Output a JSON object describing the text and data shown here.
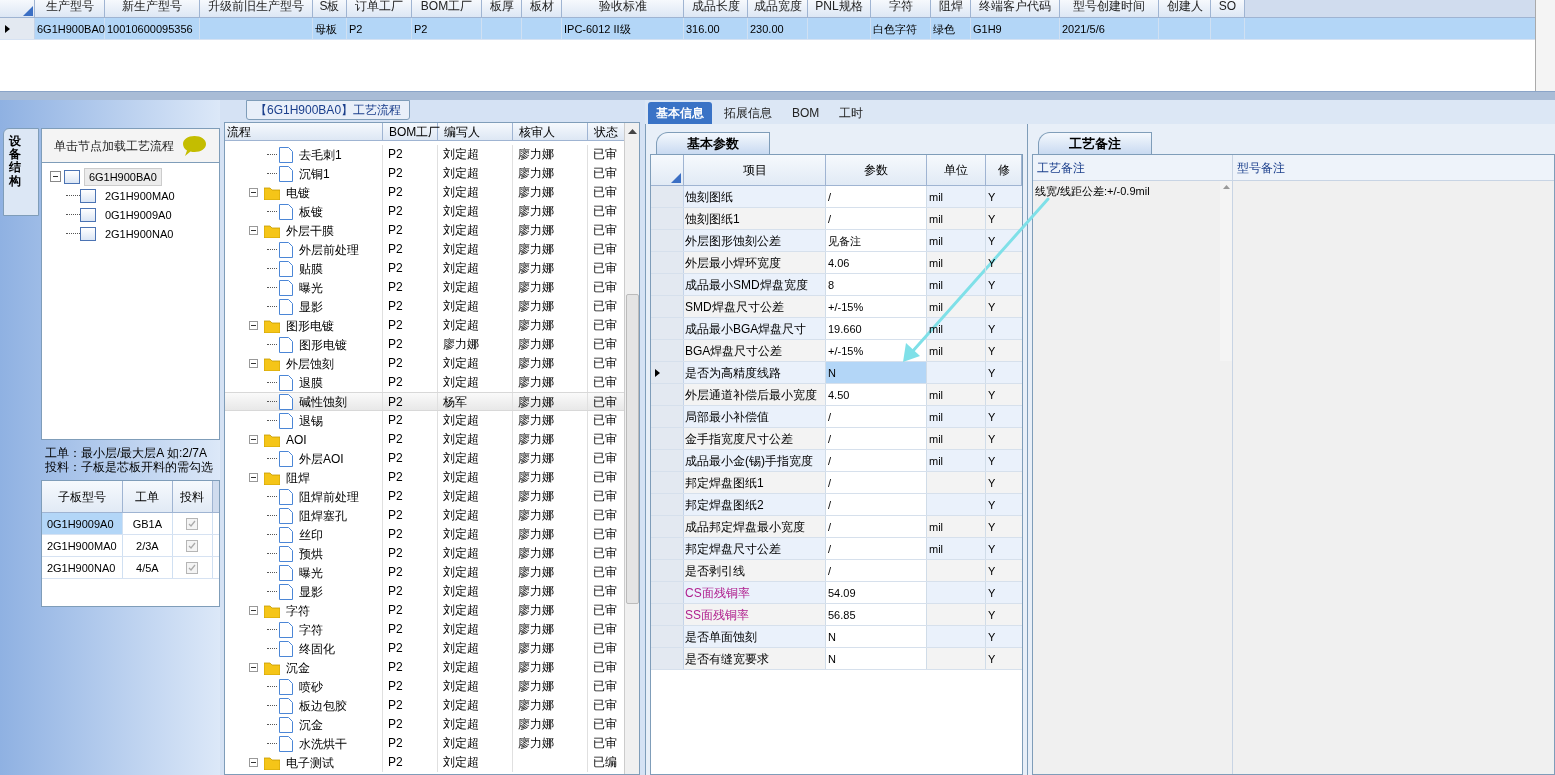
{
  "top_grid": {
    "columns": [
      "生产型号",
      "新生产型号",
      "升级前旧生产型号",
      "S板",
      "订单工厂",
      "BOM工厂",
      "板厚",
      "板材",
      "验收标准",
      "成品长度",
      "成品宽度",
      "PNL规格",
      "字符",
      "阻焊",
      "终端客户代码",
      "型号创建时间",
      "创建人",
      "SO"
    ],
    "rows": [
      {
        "selected": true,
        "cells": [
          "6G1H900BA0",
          "10010600095356",
          "",
          "母板",
          "P2",
          "P2",
          "",
          "",
          "IPC-6012 II级",
          "316.00",
          "230.00",
          "",
          "白色字符",
          "绿色",
          "G1H9",
          "2021/5/6",
          "",
          ""
        ]
      }
    ]
  },
  "left_panel": {
    "side_tab": "设备结构",
    "header": "单击节点加载工艺流程",
    "tree": [
      {
        "label": "6G1H900BA0",
        "selected": true,
        "expanded": true,
        "children": [
          {
            "label": "2G1H900MA0",
            "selected": false
          },
          {
            "label": "0G1H9009A0",
            "selected": false
          },
          {
            "label": "2G1H900NA0",
            "selected": false
          }
        ]
      }
    ],
    "note_lines": [
      "工单：最小层/最大层A 如:2/7A",
      "投料：子板是芯板开料的需勾选"
    ],
    "sub_grid": {
      "columns": [
        "子板型号",
        "工单",
        "投料"
      ],
      "rows": [
        {
          "board": "0G1H9009A0",
          "order": "GB1A",
          "checked": true,
          "selected": true
        },
        {
          "board": "2G1H900MA0",
          "order": "2/3A",
          "checked": true,
          "selected": false
        },
        {
          "board": "2G1H900NA0",
          "order": "4/5A",
          "checked": true,
          "selected": false
        }
      ]
    }
  },
  "process_panel": {
    "title": "【6G1H900BA0】工艺流程",
    "columns": [
      "流程",
      "BOM工厂",
      "编写人",
      "核审人",
      "状态"
    ],
    "rows": [
      {
        "kind": "cut",
        "children": [
          {
            "kind": "step",
            "label": "去毛刺1",
            "factory": "P2",
            "author": "刘定超",
            "reviewer": "廖力娜",
            "status": "已审",
            "selected": false
          },
          {
            "kind": "step",
            "label": "沉铜1",
            "factory": "P2",
            "author": "刘定超",
            "reviewer": "廖力娜",
            "status": "已审",
            "selected": false
          }
        ]
      },
      {
        "kind": "folder",
        "label": "电镀",
        "factory": "P2",
        "author": "刘定超",
        "reviewer": "廖力娜",
        "status": "已审",
        "expanded": true,
        "selected": false,
        "children": [
          {
            "kind": "step",
            "label": "板镀",
            "factory": "P2",
            "author": "刘定超",
            "reviewer": "廖力娜",
            "status": "已审",
            "selected": false
          }
        ]
      },
      {
        "kind": "folder",
        "label": "外层干膜",
        "factory": "P2",
        "author": "刘定超",
        "reviewer": "廖力娜",
        "status": "已审",
        "expanded": true,
        "selected": false,
        "children": [
          {
            "kind": "step",
            "label": "外层前处理",
            "factory": "P2",
            "author": "刘定超",
            "reviewer": "廖力娜",
            "status": "已审",
            "selected": false
          },
          {
            "kind": "step",
            "label": "贴膜",
            "factory": "P2",
            "author": "刘定超",
            "reviewer": "廖力娜",
            "status": "已审",
            "selected": false
          },
          {
            "kind": "step",
            "label": "曝光",
            "factory": "P2",
            "author": "刘定超",
            "reviewer": "廖力娜",
            "status": "已审",
            "selected": false
          },
          {
            "kind": "step",
            "label": "显影",
            "factory": "P2",
            "author": "刘定超",
            "reviewer": "廖力娜",
            "status": "已审",
            "selected": false
          }
        ]
      },
      {
        "kind": "folder",
        "label": "图形电镀",
        "factory": "P2",
        "author": "刘定超",
        "reviewer": "廖力娜",
        "status": "已审",
        "expanded": true,
        "selected": false,
        "children": [
          {
            "kind": "step",
            "label": "图形电镀",
            "factory": "P2",
            "author": "廖力娜",
            "reviewer": "廖力娜",
            "status": "已审",
            "selected": false
          }
        ]
      },
      {
        "kind": "folder",
        "label": "外层蚀刻",
        "factory": "P2",
        "author": "刘定超",
        "reviewer": "廖力娜",
        "status": "已审",
        "expanded": true,
        "selected": false,
        "children": [
          {
            "kind": "step",
            "label": "退膜",
            "factory": "P2",
            "author": "刘定超",
            "reviewer": "廖力娜",
            "status": "已审",
            "selected": false
          },
          {
            "kind": "step",
            "label": "碱性蚀刻",
            "factory": "P2",
            "author": "杨军",
            "reviewer": "廖力娜",
            "status": "已审",
            "selected": true
          },
          {
            "kind": "step",
            "label": "退锡",
            "factory": "P2",
            "author": "刘定超",
            "reviewer": "廖力娜",
            "status": "已审",
            "selected": false
          }
        ]
      },
      {
        "kind": "folder",
        "label": "AOI",
        "factory": "P2",
        "author": "刘定超",
        "reviewer": "廖力娜",
        "status": "已审",
        "expanded": true,
        "selected": false,
        "children": [
          {
            "kind": "step",
            "label": "外层AOI",
            "factory": "P2",
            "author": "刘定超",
            "reviewer": "廖力娜",
            "status": "已审",
            "selected": false
          }
        ]
      },
      {
        "kind": "folder",
        "label": "阻焊",
        "factory": "P2",
        "author": "刘定超",
        "reviewer": "廖力娜",
        "status": "已审",
        "expanded": true,
        "selected": false,
        "children": [
          {
            "kind": "step",
            "label": "阻焊前处理",
            "factory": "P2",
            "author": "刘定超",
            "reviewer": "廖力娜",
            "status": "已审",
            "selected": false
          },
          {
            "kind": "step",
            "label": "阻焊塞孔",
            "factory": "P2",
            "author": "刘定超",
            "reviewer": "廖力娜",
            "status": "已审",
            "selected": false
          },
          {
            "kind": "step",
            "label": "丝印",
            "factory": "P2",
            "author": "刘定超",
            "reviewer": "廖力娜",
            "status": "已审",
            "selected": false
          },
          {
            "kind": "step",
            "label": "预烘",
            "factory": "P2",
            "author": "刘定超",
            "reviewer": "廖力娜",
            "status": "已审",
            "selected": false
          },
          {
            "kind": "step",
            "label": "曝光",
            "factory": "P2",
            "author": "刘定超",
            "reviewer": "廖力娜",
            "status": "已审",
            "selected": false
          },
          {
            "kind": "step",
            "label": "显影",
            "factory": "P2",
            "author": "刘定超",
            "reviewer": "廖力娜",
            "status": "已审",
            "selected": false
          }
        ]
      },
      {
        "kind": "folder",
        "label": "字符",
        "factory": "P2",
        "author": "刘定超",
        "reviewer": "廖力娜",
        "status": "已审",
        "expanded": true,
        "selected": false,
        "children": [
          {
            "kind": "step",
            "label": "字符",
            "factory": "P2",
            "author": "刘定超",
            "reviewer": "廖力娜",
            "status": "已审",
            "selected": false
          },
          {
            "kind": "step",
            "label": "终固化",
            "factory": "P2",
            "author": "刘定超",
            "reviewer": "廖力娜",
            "status": "已审",
            "selected": false
          }
        ]
      },
      {
        "kind": "folder",
        "label": "沉金",
        "factory": "P2",
        "author": "刘定超",
        "reviewer": "廖力娜",
        "status": "已审",
        "expanded": true,
        "selected": false,
        "children": [
          {
            "kind": "step",
            "label": "喷砂",
            "factory": "P2",
            "author": "刘定超",
            "reviewer": "廖力娜",
            "status": "已审",
            "selected": false
          },
          {
            "kind": "step",
            "label": "板边包胶",
            "factory": "P2",
            "author": "刘定超",
            "reviewer": "廖力娜",
            "status": "已审",
            "selected": false
          },
          {
            "kind": "step",
            "label": "沉金",
            "factory": "P2",
            "author": "刘定超",
            "reviewer": "廖力娜",
            "status": "已审",
            "selected": false
          },
          {
            "kind": "step",
            "label": "水洗烘干",
            "factory": "P2",
            "author": "刘定超",
            "reviewer": "廖力娜",
            "status": "已审",
            "selected": false
          }
        ]
      },
      {
        "kind": "folder",
        "label": "电子测试",
        "factory": "P2",
        "author": "刘定超",
        "status": "已编",
        "expanded": true,
        "selected": false
      }
    ]
  },
  "detail_panel": {
    "tabs": [
      {
        "label": "基本信息",
        "selected": true
      },
      {
        "label": "拓展信息",
        "selected": false
      },
      {
        "label": "BOM",
        "selected": false
      },
      {
        "label": "工时",
        "selected": false
      }
    ],
    "subtab": "基本参数",
    "columns": [
      "项目",
      "参数",
      "单位",
      "修"
    ],
    "rows": [
      {
        "item": "蚀刻图纸",
        "value": "/",
        "unit": "mil",
        "modify": "Y",
        "selected": false,
        "highlighted": false
      },
      {
        "item": "蚀刻图纸1",
        "value": "/",
        "unit": "mil",
        "modify": "Y",
        "selected": false,
        "highlighted": false
      },
      {
        "item": "外层图形蚀刻公差",
        "value": "见备注",
        "unit": "mil",
        "modify": "Y",
        "selected": false,
        "highlighted": false
      },
      {
        "item": "外层最小焊环宽度",
        "value": "4.06",
        "unit": "mil",
        "modify": "Y",
        "selected": false,
        "highlighted": false
      },
      {
        "item": "成品最小SMD焊盘宽度",
        "value": "8",
        "unit": "mil",
        "modify": "Y",
        "selected": false,
        "highlighted": false
      },
      {
        "item": "SMD焊盘尺寸公差",
        "value": "+/-15%",
        "unit": "mil",
        "modify": "Y",
        "selected": false,
        "highlighted": false
      },
      {
        "item": "成品最小BGA焊盘尺寸",
        "value": "19.660",
        "unit": "mil",
        "modify": "Y",
        "selected": false,
        "highlighted": false
      },
      {
        "item": "BGA焊盘尺寸公差",
        "value": "+/-15%",
        "unit": "mil",
        "modify": "Y",
        "selected": false,
        "highlighted": false
      },
      {
        "item": "是否为高精度线路",
        "value": "N",
        "modify": "Y",
        "selected": true,
        "highlighted": false
      },
      {
        "item": "外层通道补偿后最小宽度",
        "value": "4.50",
        "unit": "mil",
        "modify": "Y",
        "selected": false,
        "highlighted": false
      },
      {
        "item": "局部最小补偿值",
        "value": "/",
        "unit": "mil",
        "modify": "Y",
        "selected": false,
        "highlighted": false
      },
      {
        "item": "金手指宽度尺寸公差",
        "value": "/",
        "unit": "mil",
        "modify": "Y",
        "selected": false,
        "highlighted": false
      },
      {
        "item": "成品最小金(锡)手指宽度",
        "value": "/",
        "unit": "mil",
        "modify": "Y",
        "selected": false,
        "highlighted": false
      },
      {
        "item": "邦定焊盘图纸1",
        "value": "/",
        "modify": "Y",
        "selected": false,
        "highlighted": false
      },
      {
        "item": "邦定焊盘图纸2",
        "value": "/",
        "modify": "Y",
        "selected": false,
        "highlighted": false
      },
      {
        "item": "成品邦定焊盘最小宽度",
        "value": "/",
        "unit": "mil",
        "modify": "Y",
        "selected": false,
        "highlighted": false
      },
      {
        "item": "邦定焊盘尺寸公差",
        "value": "/",
        "unit": "mil",
        "modify": "Y",
        "selected": false,
        "highlighted": false
      },
      {
        "item": "是否剥引线",
        "value": "/",
        "modify": "Y",
        "selected": false,
        "highlighted": false
      },
      {
        "item": "CS面残铜率",
        "value": "54.09",
        "modify": "Y",
        "selected": false,
        "highlighted": true
      },
      {
        "item": "SS面残铜率",
        "value": "56.85",
        "modify": "Y",
        "selected": false,
        "highlighted": true
      },
      {
        "item": "是否单面蚀刻",
        "value": "N",
        "modify": "Y",
        "selected": false,
        "highlighted": false
      },
      {
        "item": "是否有缝宽要求",
        "value": "N",
        "modify": "Y",
        "selected": false,
        "highlighted": false
      }
    ]
  },
  "remarks_panel": {
    "subtab": "工艺备注",
    "columns": [
      "工艺备注",
      "型号备注"
    ],
    "text": "线宽/线距公差:+/-0.9mil"
  }
}
